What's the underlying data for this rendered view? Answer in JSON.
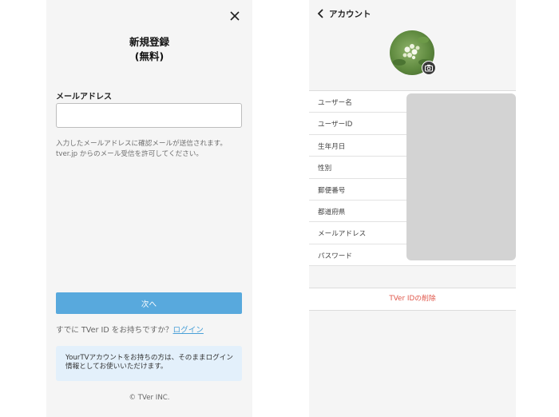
{
  "signup": {
    "title_line1": "新規登録",
    "title_line2": "(無料)",
    "email_label": "メールアドレス",
    "email_value": "",
    "email_placeholder": "",
    "helper_line1": "入力したメールアドレスに確認メールが送信されます。",
    "helper_line2": "tver.jp からのメール受信を許可してください。",
    "next_button": "次へ",
    "login_prompt": "すでに TVer ID をお持ちですか？",
    "login_link": "ログイン",
    "info_line1": "YourTVアカウントをお持ちの方は、そのままログイン",
    "info_line2": "情報としてお使いいただけます。",
    "copyright": "© TVer INC."
  },
  "account": {
    "back_label": "アカウント",
    "fields": [
      {
        "label": "ユーザー名"
      },
      {
        "label": "ユーザーID"
      },
      {
        "label": "生年月日"
      },
      {
        "label": "性別"
      },
      {
        "label": "郵便番号"
      },
      {
        "label": "都道府県"
      },
      {
        "label": "メールアドレス"
      },
      {
        "label": "パスワード"
      }
    ],
    "delete_label": "TVer IDの削除"
  },
  "colors": {
    "primary_button": "#58a9dd",
    "link": "#4aa0d8",
    "info_bg": "#e3f0fb",
    "danger": "#e0584b",
    "masked_values": "#d3d3d3"
  },
  "icons": [
    "close-icon",
    "back-chevron-icon",
    "camera-icon"
  ]
}
